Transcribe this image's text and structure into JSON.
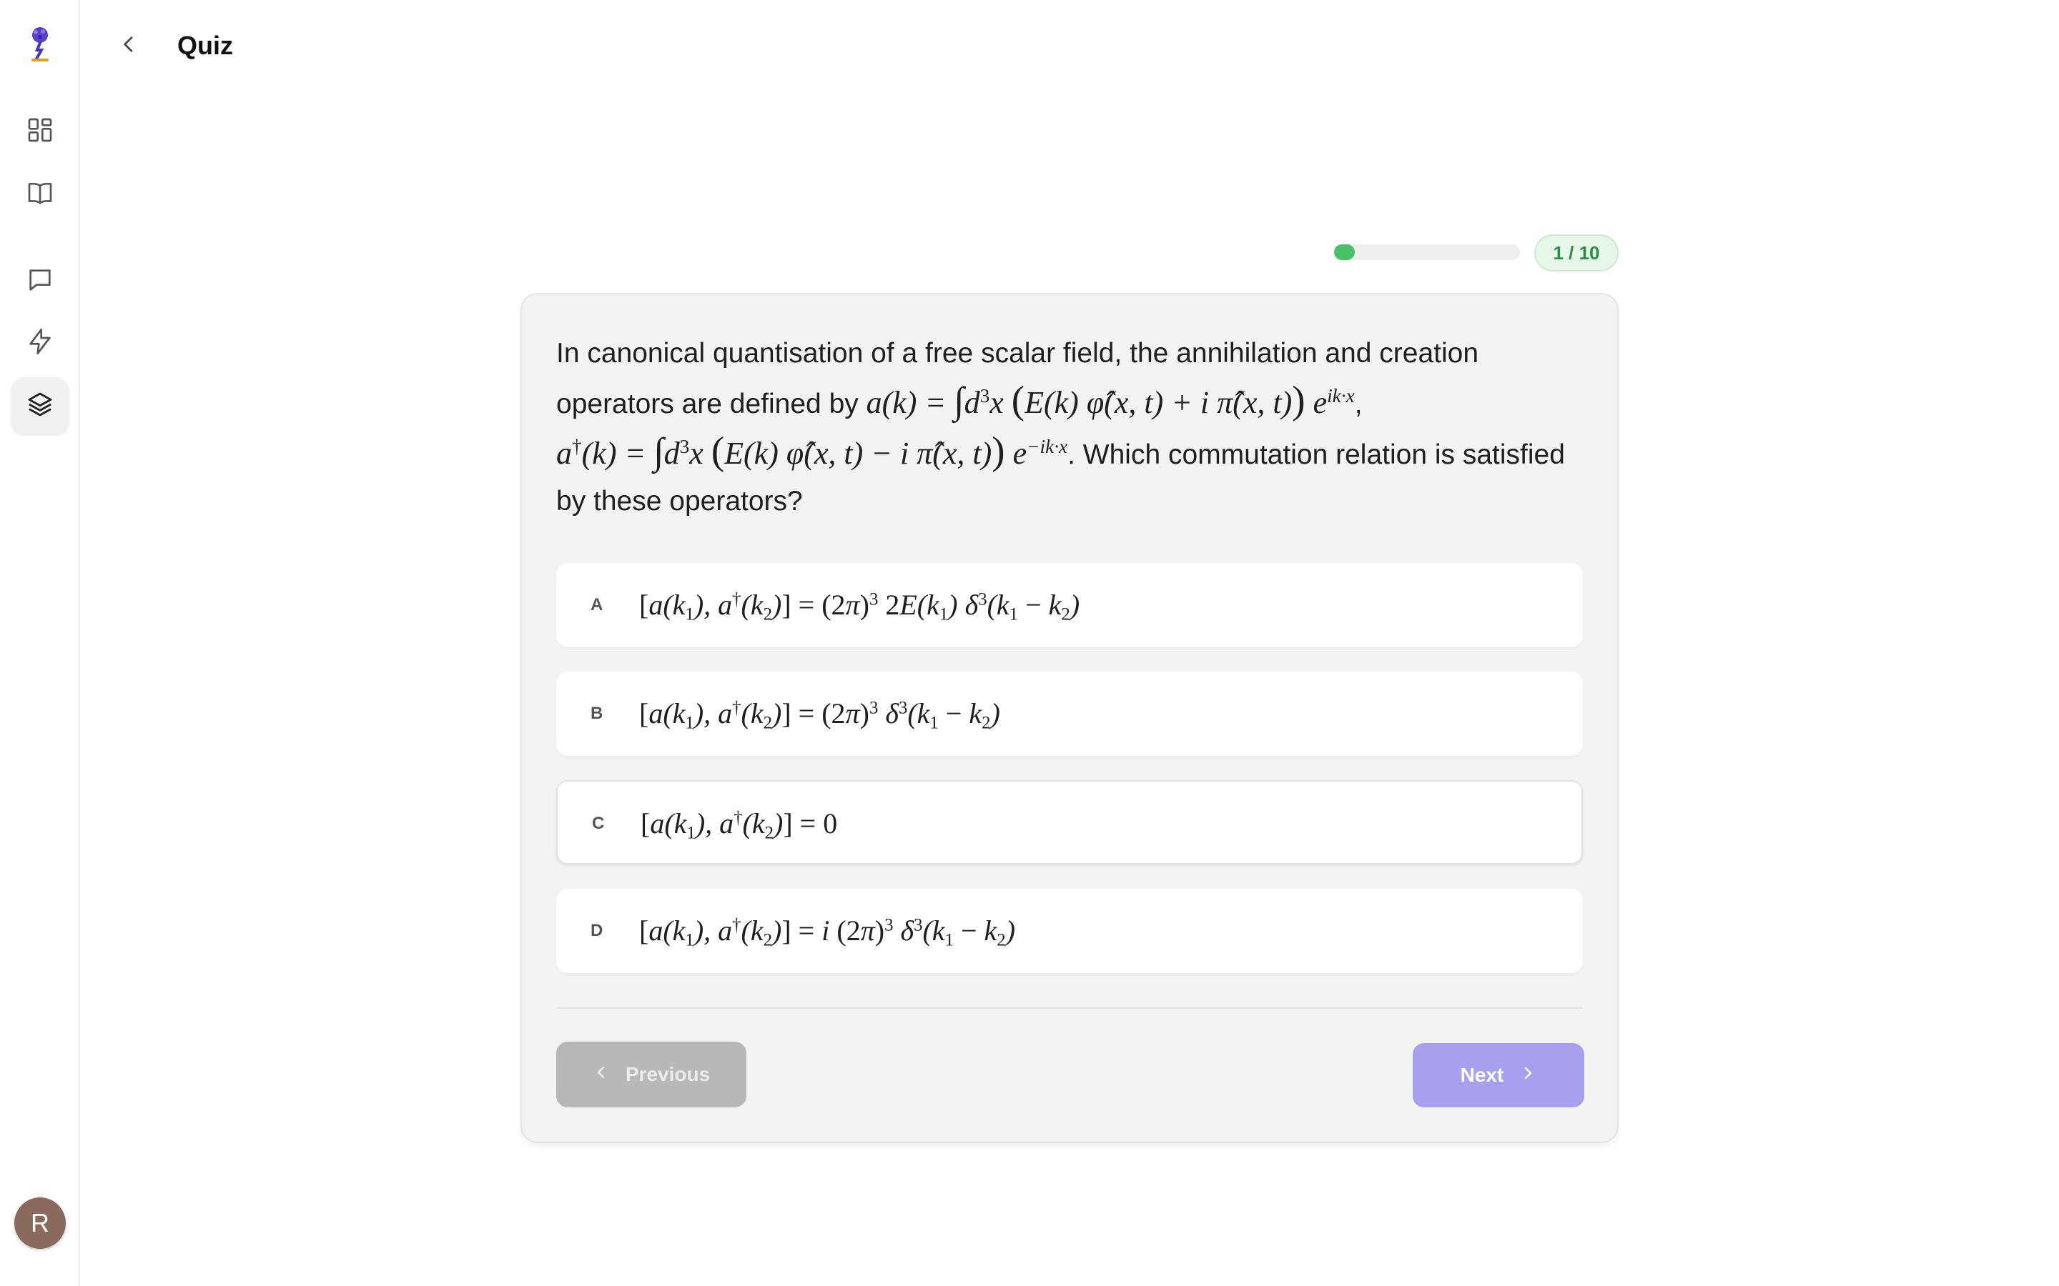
{
  "header": {
    "title": "Quiz"
  },
  "sidebar": {
    "logo": "genie-logo",
    "items": [
      {
        "icon": "dashboard-icon"
      },
      {
        "icon": "book-icon"
      },
      {
        "icon": "chat-icon"
      },
      {
        "icon": "lightning-icon"
      },
      {
        "icon": "layers-icon",
        "active": true
      }
    ],
    "avatar_initial": "R"
  },
  "progress": {
    "current": 1,
    "total": 10,
    "label": "1 / 10",
    "fill_fraction": 0.1
  },
  "question": {
    "text_1": "In canonical quantisation of a free scalar field, the annihilation and creation operators are defined by",
    "text_2": ". Which commutation relation is satisfied by these operators?",
    "formula_a": "a(k) = ∫ d³x (E(k) φ̂(x,t) + i π̂(x,t)) e^{ik·x}",
    "formula_a_dagger": "a†(k) = ∫ d³x (E(k) φ̂(x,t) − i π̂(x,t)) e^{−ik·x}"
  },
  "options": [
    {
      "letter": "A",
      "formula": "[a(k₁), a†(k₂)] = (2π)³ 2E(k₁) δ³(k₁ − k₂)"
    },
    {
      "letter": "B",
      "formula": "[a(k₁), a†(k₂)] = (2π)³ δ³(k₁ − k₂)"
    },
    {
      "letter": "C",
      "formula": "[a(k₁), a†(k₂)] = 0"
    },
    {
      "letter": "D",
      "formula": "[a(k₁), a†(k₂)] = i (2π)³ δ³(k₁ − k₂)"
    }
  ],
  "navigation": {
    "previous_label": "Previous",
    "next_label": "Next"
  },
  "colors": {
    "accent": "#a7a0ef",
    "progress": "#4bc26a",
    "badge_bg": "#e6f6e8",
    "badge_text": "#2f8c45",
    "card_bg": "#f3f3f1",
    "disabled": "#b8b8b8"
  }
}
